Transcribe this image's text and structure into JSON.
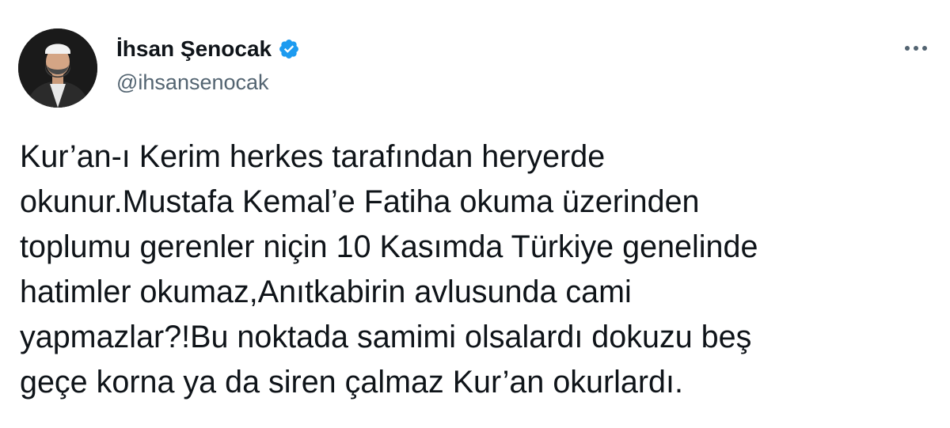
{
  "user": {
    "display_name": "İhsan Şenocak",
    "handle": "@ihsansenocak",
    "verified_icon": "verified-badge-icon",
    "accent_color": "#1d9bf0"
  },
  "actions": {
    "more_icon": "more-options-icon"
  },
  "tweet": {
    "lines": [
      "Kur’an-ı Kerim herkes tarafından heryerde",
      "okunur.Mustafa Kemal’e Fatiha okuma üzerinden",
      "toplumu gerenler niçin 10 Kasımda Türkiye genelinde",
      "hatimler okumaz,Anıtkabirin avlusunda cami",
      "yapmazlar?!Bu noktada samimi olsalardı dokuzu beş",
      "geçe korna ya da siren çalmaz Kur’an okurlardı."
    ]
  }
}
